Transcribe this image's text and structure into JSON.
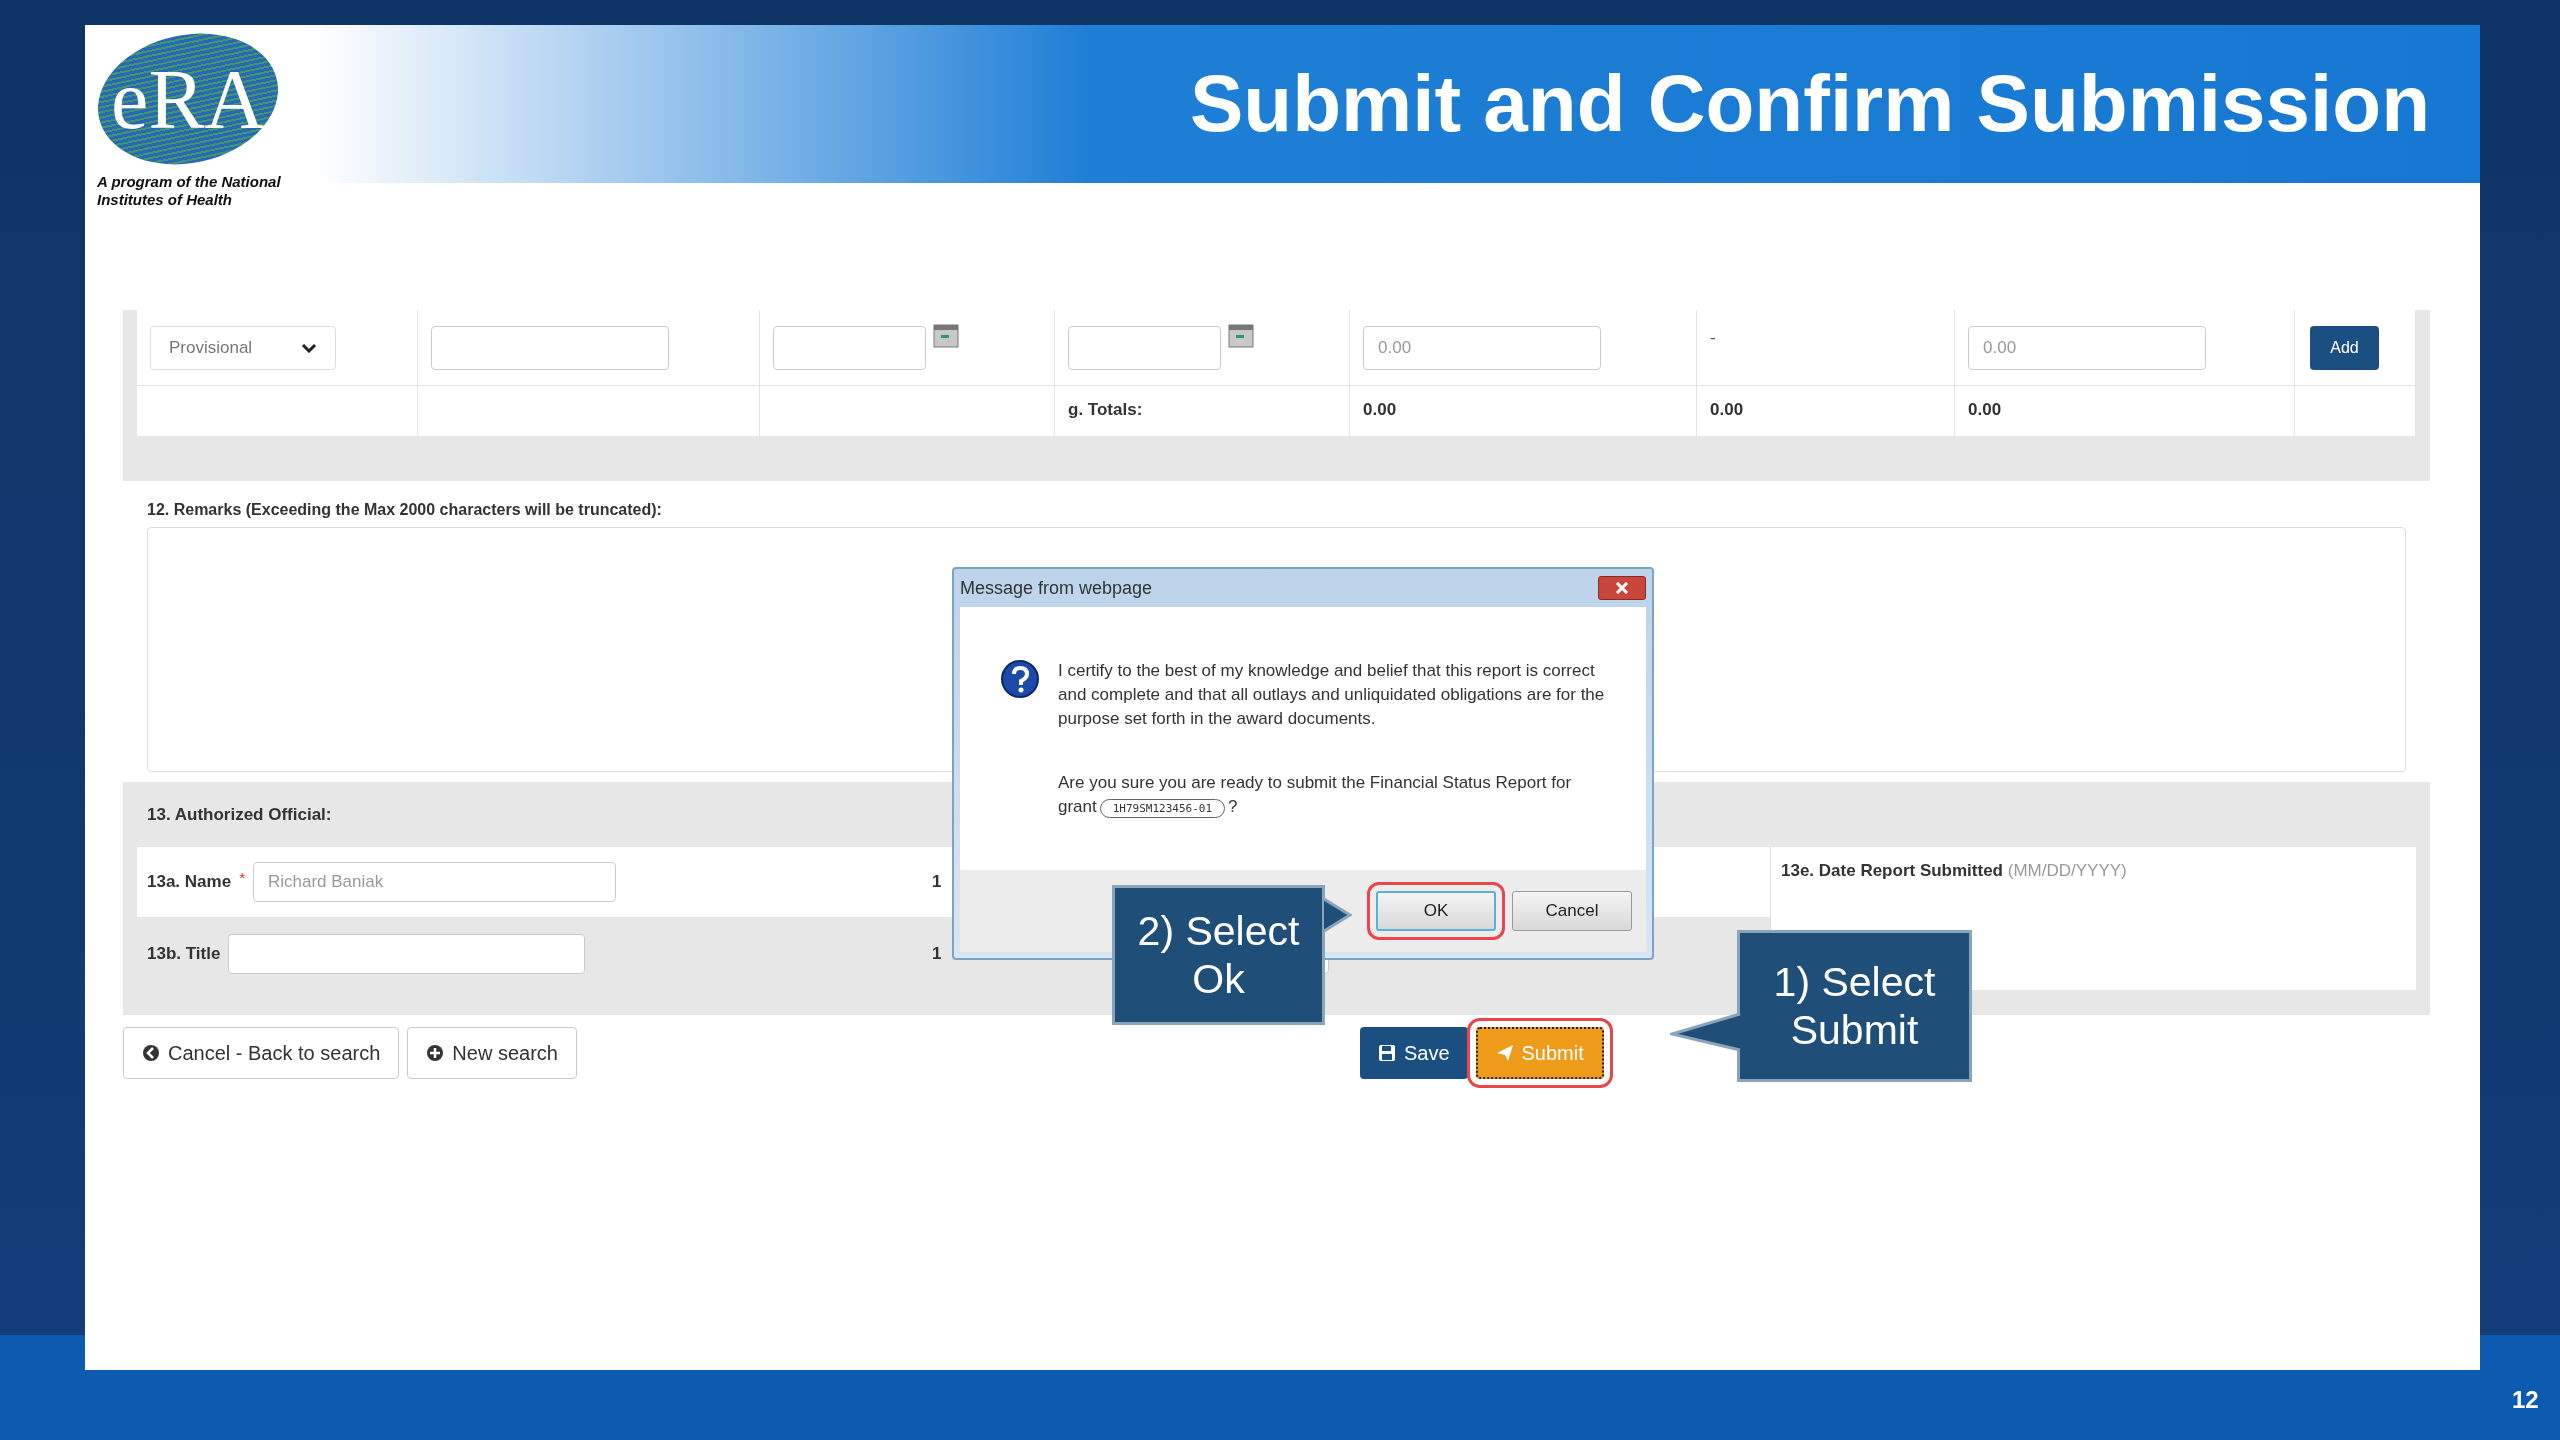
{
  "header": {
    "logo_text": "eRA",
    "tagline": "A program of the National Institutes of Health",
    "title": "Submit and Confirm Submission"
  },
  "expenditure_row": {
    "cells": [
      {
        "kind": "select",
        "value": "Provisional"
      },
      {
        "kind": "input"
      },
      {
        "kind": "date"
      },
      {
        "kind": "date"
      },
      {
        "kind": "input",
        "placeholder": "0.00"
      },
      {
        "kind": "text",
        "value": "-"
      },
      {
        "kind": "input",
        "placeholder": "0.00"
      },
      {
        "kind": "button",
        "label": "Add"
      }
    ]
  },
  "totals": {
    "label": "g. Totals:",
    "values": [
      "0.00",
      "0.00",
      "0.00"
    ]
  },
  "remarks": {
    "label": "12. Remarks (Exceeding the Max 2000 characters will be truncated):"
  },
  "authorized_official": {
    "heading": "13. Authorized Official:",
    "name": {
      "label": "13a. Name",
      "required_mark": "*",
      "placeholder": "Richard Baniak"
    },
    "title": {
      "label": "13b. Title"
    },
    "hidden_labels": [
      "1",
      "1"
    ],
    "date": {
      "label": "13e. Date Report Submitted",
      "hint": "(MM/DD/YYYY)"
    }
  },
  "buttons": [
    {
      "kind": "back",
      "label": "Cancel - Back to search",
      "highlighted": false
    },
    {
      "kind": "new",
      "label": "New search",
      "highlighted": false
    },
    {
      "kind": "save",
      "label": "Save",
      "highlighted": false
    },
    {
      "kind": "submit",
      "label": "Submit",
      "highlighted": true
    }
  ],
  "dialog": {
    "title": "Message from webpage",
    "message": "I certify to the best of my knowledge and belief that this report is correct and complete and that all outlays and unliquidated obligations are for the purpose set forth in the award documents.",
    "question": "Are you sure you are ready to submit the Financial Status Report for grant",
    "grant": "1H79SM123456-01",
    "suffix": "?",
    "buttons": [
      {
        "label": "OK",
        "highlighted": true
      },
      {
        "label": "Cancel",
        "highlighted": false
      }
    ]
  },
  "callouts": [
    {
      "kind": "left",
      "text": "1) Select Submit"
    },
    {
      "kind": "right",
      "text": "2) Select Ok"
    }
  ],
  "slide_number": "12"
}
